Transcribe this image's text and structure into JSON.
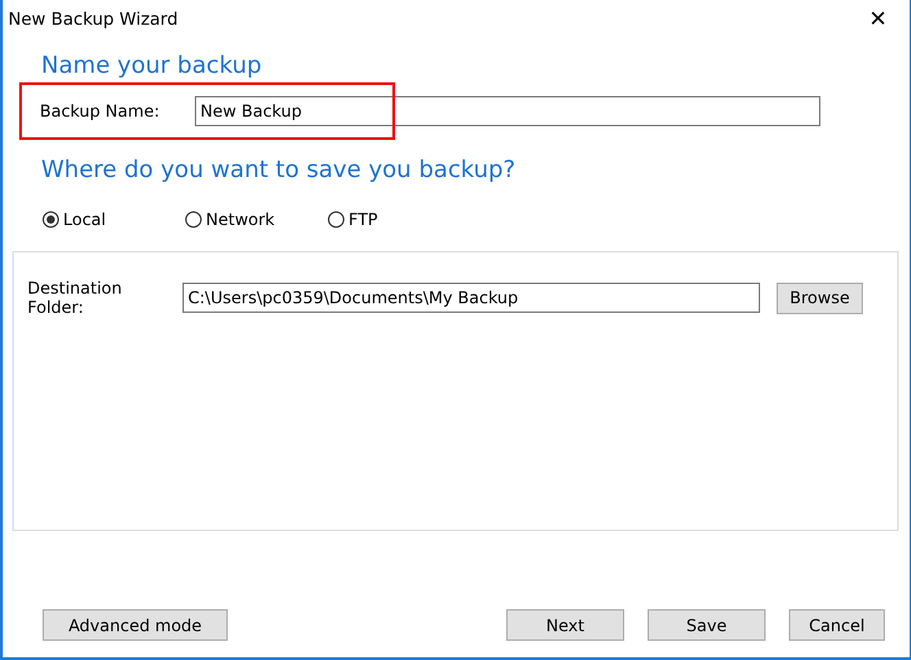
{
  "window": {
    "title": "New Backup Wizard",
    "close": "✕"
  },
  "heading": "Name your backup",
  "backup_name": {
    "label": "Backup Name:",
    "value": "New Backup",
    "highlighted": true
  },
  "location_heading": "Where do you want to save you backup?",
  "locations": [
    {
      "label": "Local",
      "selected": true
    },
    {
      "label": "Network",
      "selected": false
    },
    {
      "label": "FTP",
      "selected": false
    }
  ],
  "destination": {
    "label": "Destination Folder:",
    "value": "C:\\Users\\pc0359\\Documents\\My Backup",
    "browse": "Browse"
  },
  "left_button": "Advanced mode",
  "buttons": [
    "Next",
    "Save",
    "Cancel"
  ]
}
